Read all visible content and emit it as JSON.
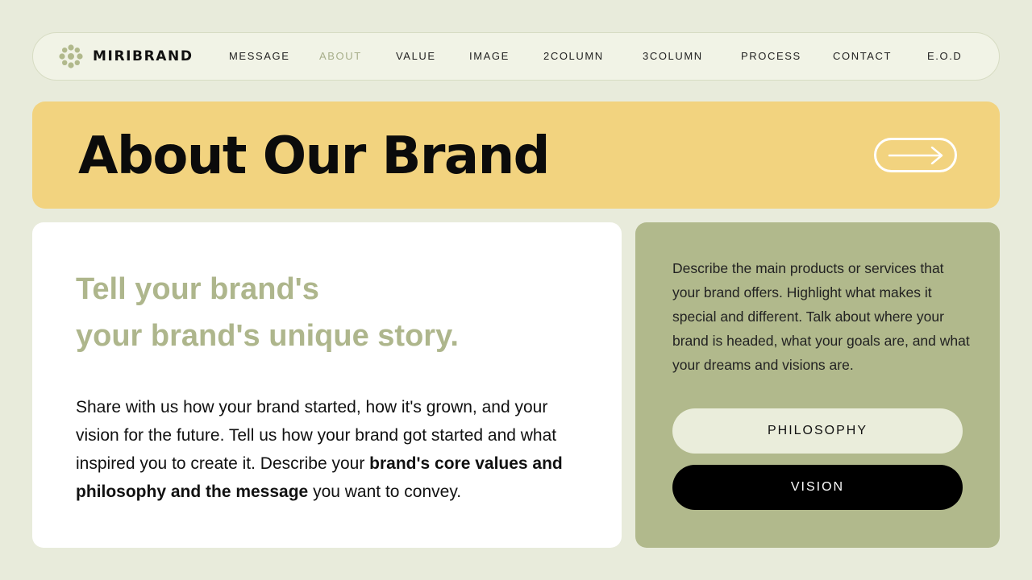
{
  "nav": {
    "brand": "MIRIBRAND",
    "logo_icon": "flower-dots-icon",
    "items": [
      {
        "label": "MESSAGE"
      },
      {
        "label": "ABOUT",
        "active": true
      },
      {
        "label": "VALUE"
      },
      {
        "label": "IMAGE"
      },
      {
        "label": "2COLUMN"
      },
      {
        "label": "3COLUMN"
      },
      {
        "label": "PROCESS"
      },
      {
        "label": "CONTACT"
      },
      {
        "label": "E.O.D"
      }
    ]
  },
  "hero": {
    "title": "About Our Brand",
    "arrow_icon": "arrow-right-icon"
  },
  "left": {
    "headline_line1": "Tell your brand's",
    "headline_line2": "your brand's unique story.",
    "body_plain": "Share with us how your brand started, how it's grown, and your vision for the future. Tell us how your brand got started and what inspired you to create it. Describe your ",
    "body_bold": "brand's core values and philosophy and the message",
    "body_end": " you want to convey."
  },
  "right": {
    "description": "Describe the main products or services that your brand offers. Highlight what makes it special and different. Talk about where your brand is headed, what your goals are, and what your dreams and visions are.",
    "button_philosophy": "PHILOSOPHY",
    "button_vision": "VISION"
  },
  "colors": {
    "background": "#e8ebdb",
    "hero": "#f2d37f",
    "accent_green": "#b1b98c",
    "headline_green": "#aeb68c"
  }
}
